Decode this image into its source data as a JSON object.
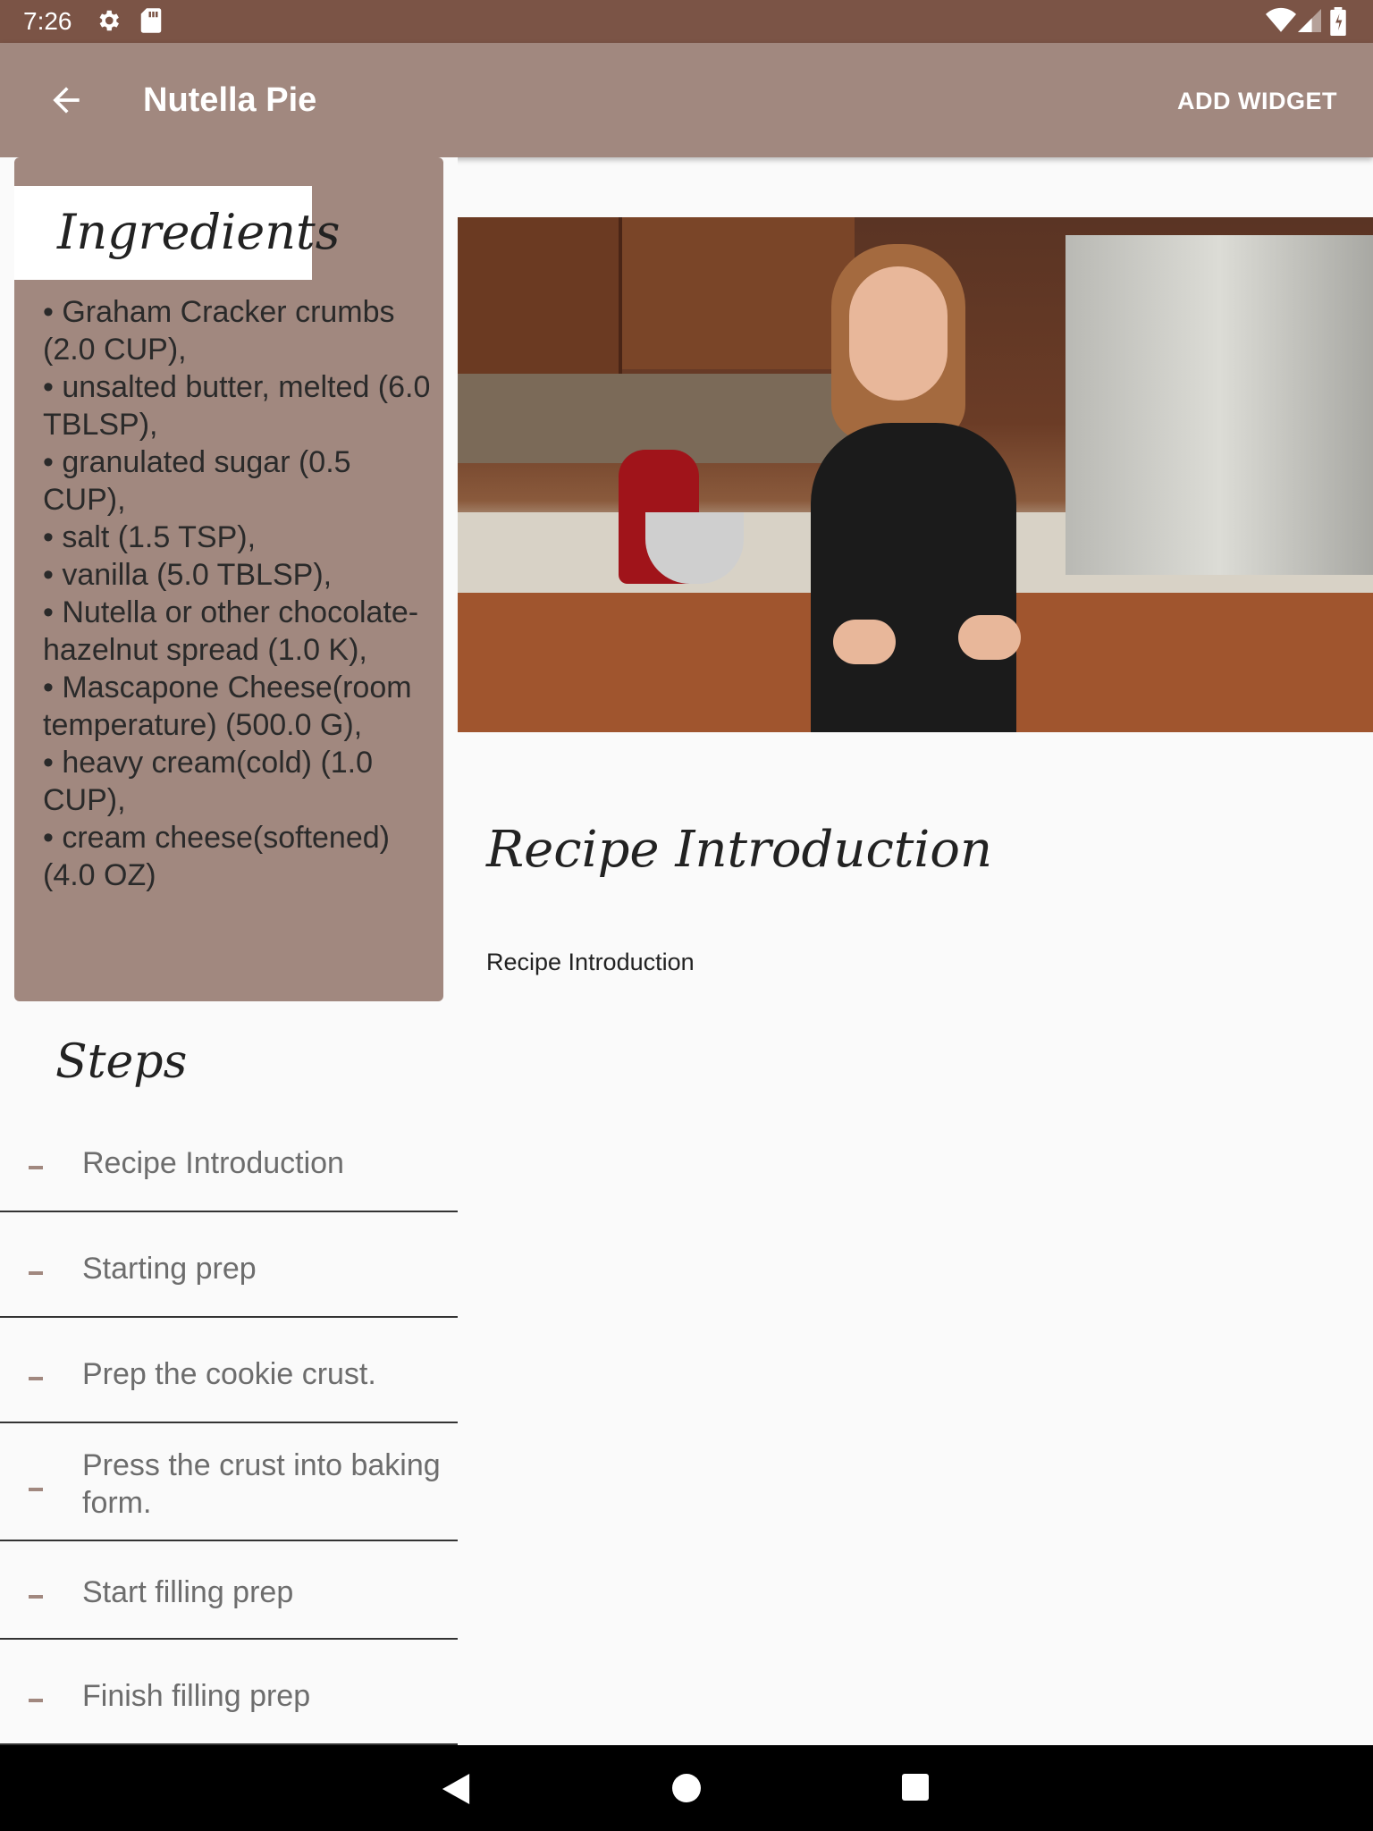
{
  "status_bar": {
    "time": "7:26",
    "icons": [
      "gear-icon",
      "sd-card-icon",
      "wifi-icon",
      "signal-icon",
      "battery-icon"
    ],
    "color": "#7b5446"
  },
  "app_bar": {
    "title": "Nutella Pie",
    "action": "ADD WIDGET",
    "back_icon": "arrow-back-icon",
    "color": "#a1887f"
  },
  "ingredients": {
    "heading": "Ingredients",
    "items": [
      "• Graham Cracker crumbs (2.0 CUP),",
      "• unsalted butter, melted (6.0 TBLSP),",
      "• granulated sugar (0.5 CUP),",
      "• salt (1.5 TSP),",
      "• vanilla (5.0 TBLSP),",
      "• Nutella or other chocolate-hazelnut spread (1.0 K),",
      "• Mascapone Cheese(room temperature) (500.0 G),",
      "• heavy cream(cold) (1.0 CUP),",
      "• cream cheese(softened) (4.0 OZ)"
    ]
  },
  "steps": {
    "heading": "Steps",
    "items": [
      "Recipe Introduction",
      "Starting prep",
      "Prep the cookie crust.",
      "Press the crust into baking form.",
      "Start filling prep",
      "Finish filling prep"
    ]
  },
  "detail": {
    "title": "Recipe Introduction",
    "description": "Recipe Introduction",
    "media": "video-player"
  },
  "nav_bar": {
    "icons": [
      "back-triangle-icon",
      "home-circle-icon",
      "recents-square-icon"
    ]
  }
}
